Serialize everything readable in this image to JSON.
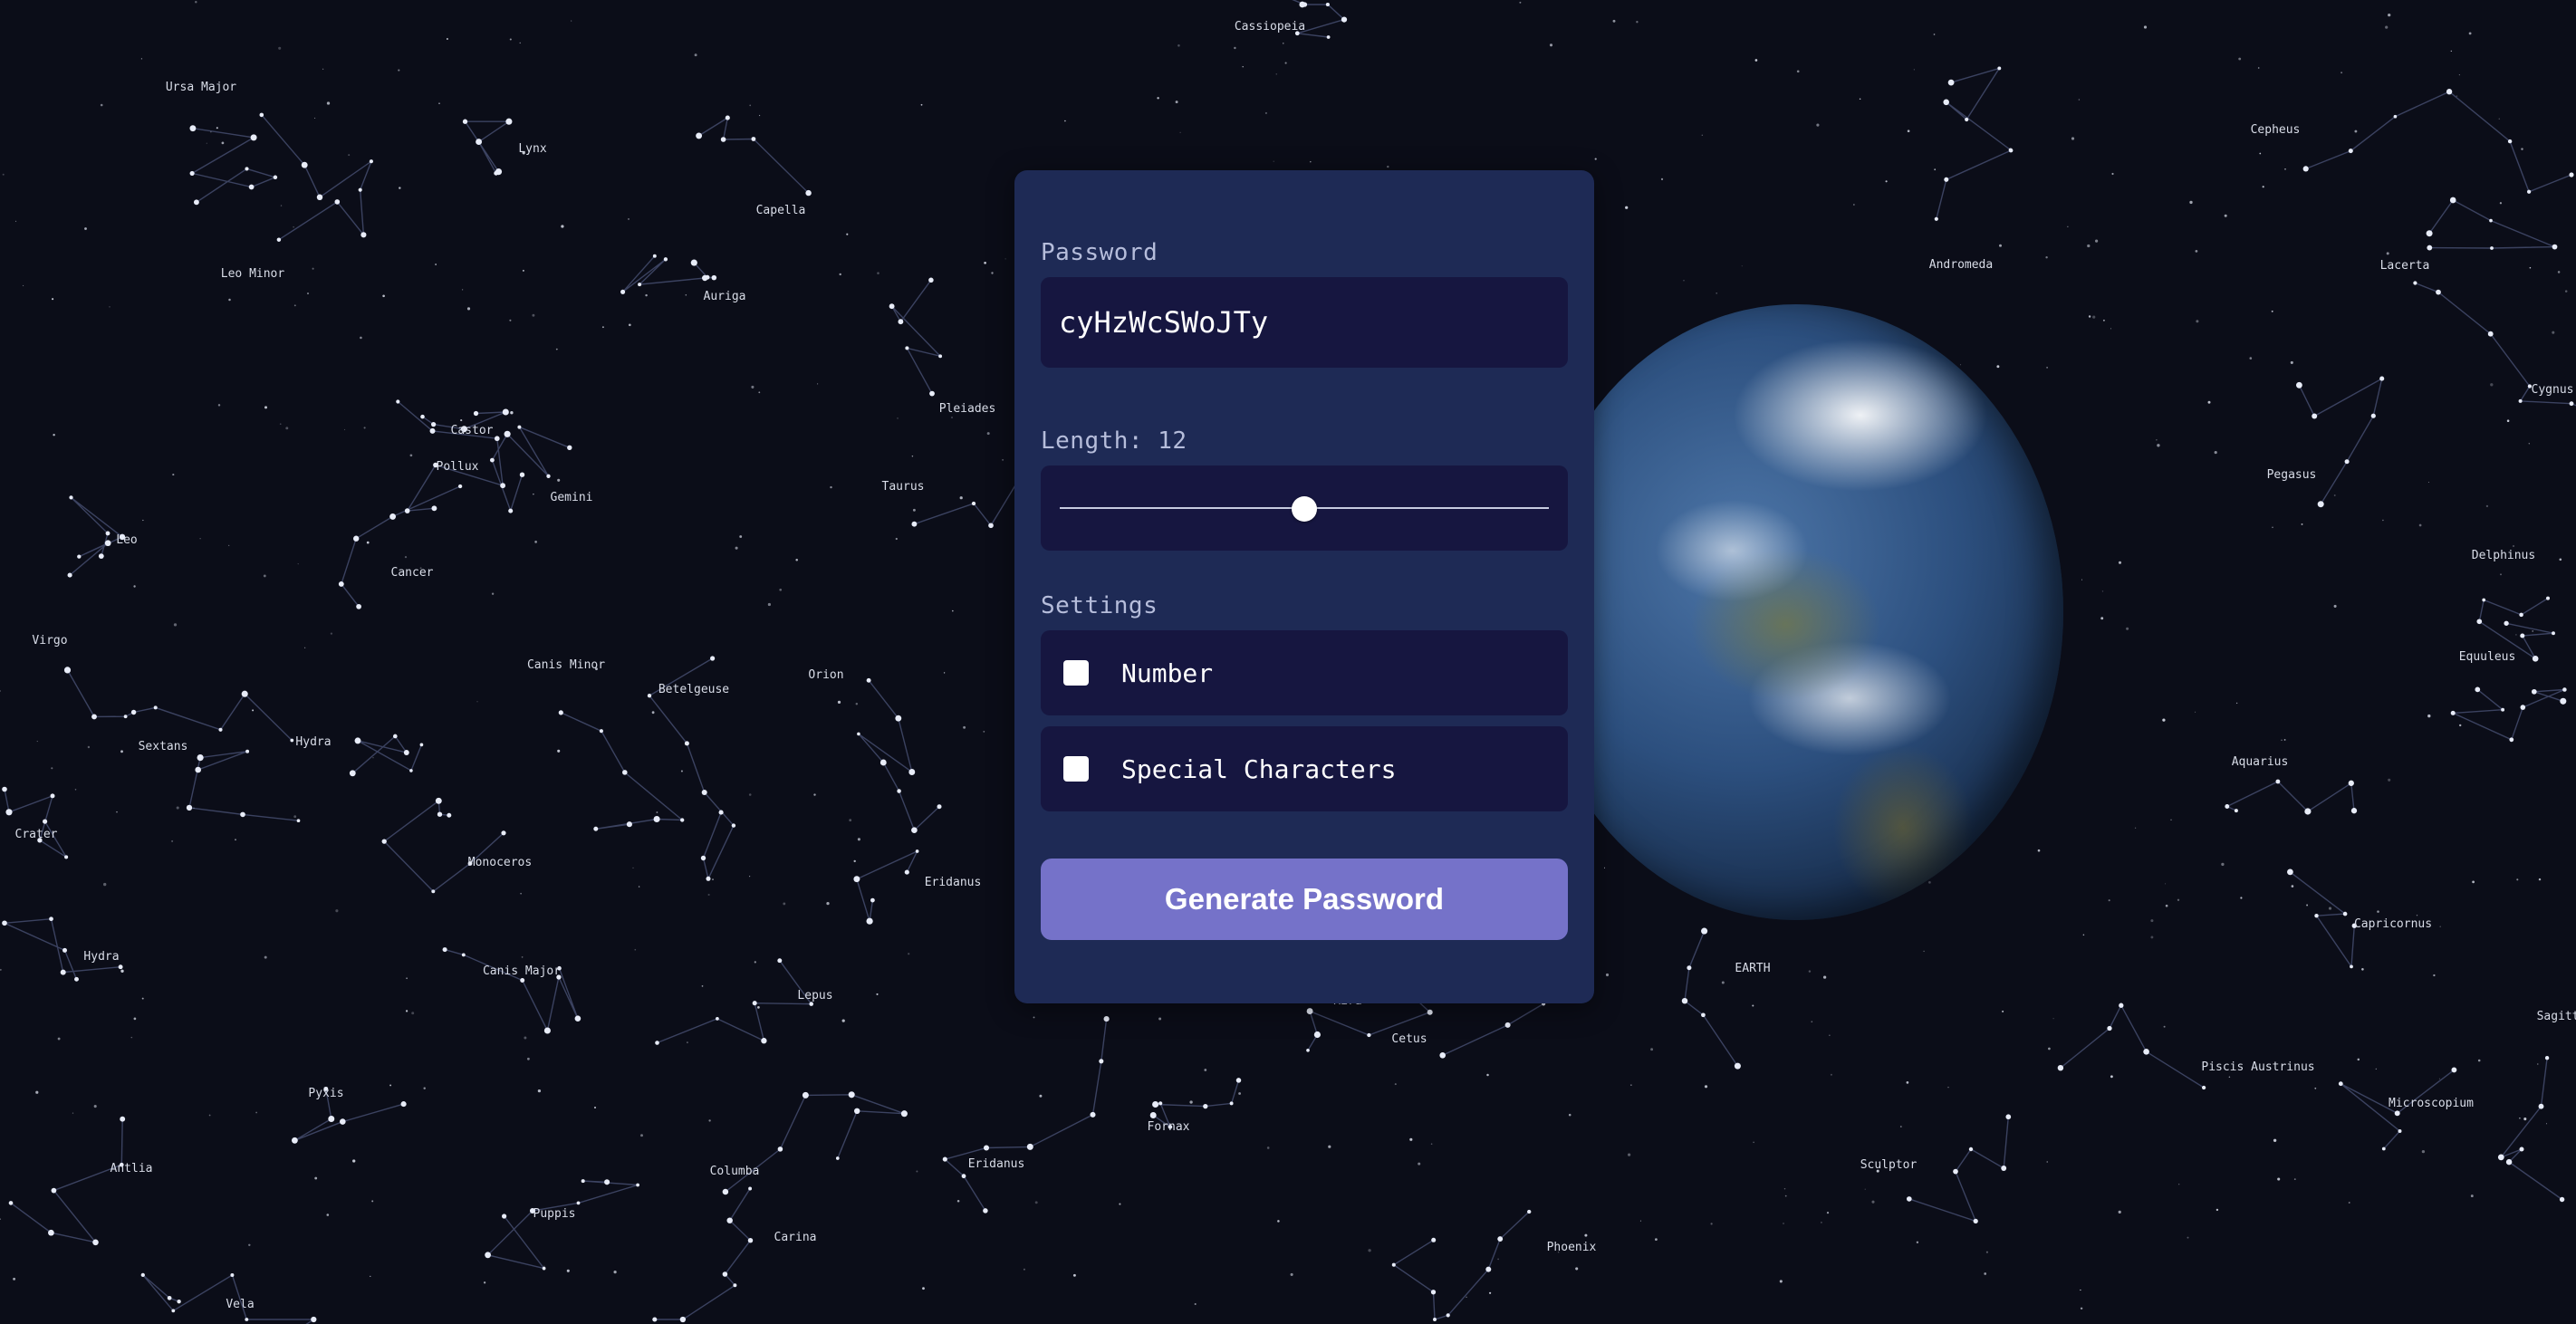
{
  "password": {
    "label": "Password",
    "value": "cyHzWcSWoJTy"
  },
  "length": {
    "label": "Length: 12",
    "value": 12,
    "min": 4,
    "max": 20
  },
  "settings": {
    "label": "Settings",
    "options": [
      {
        "label": "Number",
        "checked": false
      },
      {
        "label": "Special Characters",
        "checked": false
      }
    ]
  },
  "generate_button_label": "Generate Password",
  "background": {
    "constellations": [
      "Ursa Major",
      "Lynx",
      "Leo Minor",
      "Cassiopeia",
      "Capella",
      "Auriga",
      "Castor",
      "Pollux",
      "Gemini",
      "Cancer",
      "Leo",
      "Virgo",
      "Canis Minor",
      "Betelgeuse",
      "Orion",
      "Sextans",
      "Hydra",
      "Crater",
      "Monoceros",
      "Hydra",
      "Canis Major",
      "Lepus",
      "Eridanus",
      "Pleiades",
      "Taurus",
      "Pyxis",
      "Antlia",
      "Columba",
      "Puppis",
      "Carina",
      "Vela",
      "Eridanus",
      "Fornax",
      "Mira",
      "Cetus",
      "Phoenix",
      "Sculptor",
      "EARTH",
      "Andromeda",
      "Cepheus",
      "Lacerta",
      "Cygnus",
      "Pegasus",
      "Delphinus",
      "Equuleus",
      "Aquarius",
      "Capricornus",
      "Piscis Austrinus",
      "Microscopium",
      "Sagitta"
    ],
    "colors": {
      "sky": "#0b0d18",
      "card": "#1e2a55",
      "field": "#161640",
      "button": "#7572c9",
      "constellation_line": "#3b4260",
      "star": "#e8ecf8"
    }
  }
}
